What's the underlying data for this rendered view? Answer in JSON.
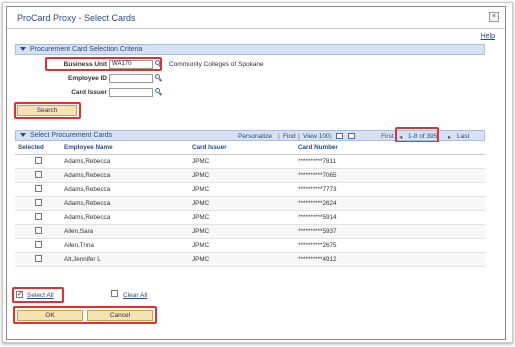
{
  "window": {
    "title": "ProCard Proxy - Select Cards",
    "close_glyph": "×",
    "help_label": "Help"
  },
  "criteria": {
    "section_title": "Procurement Card Selection Criteria",
    "business_unit_label": "Business Unit",
    "business_unit_value": "WA170",
    "business_unit_desc": "Community Colleges of Spokane",
    "employee_id_label": "Employee ID",
    "employee_id_value": "",
    "card_issuer_label": "Card Issuer",
    "card_issuer_value": "",
    "search_label": "Search"
  },
  "grid": {
    "title": "Select Procurement Cards",
    "personalize": "Personalize",
    "find": "Find",
    "view": "View 100",
    "first": "First",
    "range": "1-8 of 395",
    "last": "Last",
    "columns": [
      "Selected",
      "Employee Name",
      "Card Issuer",
      "Card Number"
    ],
    "rows": [
      {
        "name": "Adams,Rebecca",
        "issuer": "JPMC",
        "card": "**********7811"
      },
      {
        "name": "Adams,Rebecca",
        "issuer": "JPMC",
        "card": "**********7065"
      },
      {
        "name": "Adams,Rebecca",
        "issuer": "JPMC",
        "card": "**********7773"
      },
      {
        "name": "Adams,Rebecca",
        "issuer": "JPMC",
        "card": "**********2624"
      },
      {
        "name": "Adams,Rebecca",
        "issuer": "JPMC",
        "card": "**********5914"
      },
      {
        "name": "Allen,Sara",
        "issuer": "JPMC",
        "card": "**********5937"
      },
      {
        "name": "Allen,Trina",
        "issuer": "JPMC",
        "card": "**********2675"
      },
      {
        "name": "Alt,Jennifer L",
        "issuer": "JPMC",
        "card": "**********4912"
      }
    ]
  },
  "footer": {
    "select_all": "Select All",
    "clear_all": "Clear All",
    "ok": "OK",
    "cancel": "Cancel"
  },
  "colors": {
    "highlight": "#e03030",
    "link": "#2a4a8a",
    "header_bg": "#d6e2f3",
    "button_bg": "#f4e3b7"
  }
}
